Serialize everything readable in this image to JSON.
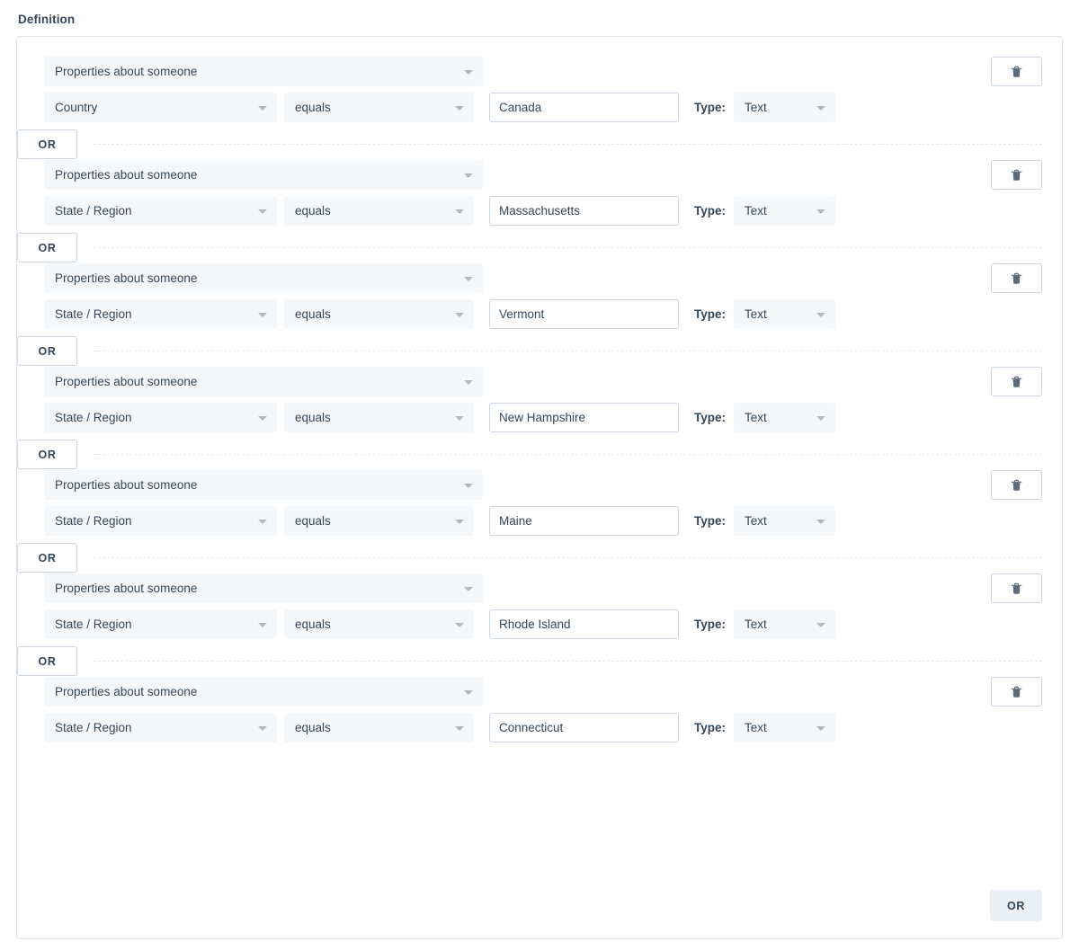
{
  "section": {
    "label": "Definition"
  },
  "icons": {
    "trash": "trash-icon",
    "caret": "chevron-down-icon"
  },
  "labels": {
    "type_label": "Type:",
    "or_label": "OR"
  },
  "colors": {
    "accent_text": "#33475b",
    "field_bg": "#f5f8fa",
    "border": "#cbd6e2",
    "container_border": "#e3e6e8",
    "or_filled_bg": "#eaf0f6"
  },
  "filter_groups": [
    {
      "object_type": "Properties about someone",
      "property": "Country",
      "operator": "equals",
      "value": "Canada",
      "value_type": "Text",
      "delete_label": "",
      "has_or_separator": true
    },
    {
      "object_type": "Properties about someone",
      "property": "State / Region",
      "operator": "equals",
      "value": "Massachusetts",
      "value_type": "Text",
      "delete_label": "",
      "has_or_separator": true
    },
    {
      "object_type": "Properties about someone",
      "property": "State / Region",
      "operator": "equals",
      "value": "Vermont",
      "value_type": "Text",
      "delete_label": "",
      "has_or_separator": true
    },
    {
      "object_type": "Properties about someone",
      "property": "State / Region",
      "operator": "equals",
      "value": "New Hampshire",
      "value_type": "Text",
      "delete_label": "",
      "has_or_separator": true
    },
    {
      "object_type": "Properties about someone",
      "property": "State / Region",
      "operator": "equals",
      "value": "Maine",
      "value_type": "Text",
      "delete_label": "",
      "has_or_separator": true
    },
    {
      "object_type": "Properties about someone",
      "property": "State / Region",
      "operator": "equals",
      "value": "Rhode Island",
      "value_type": "Text",
      "delete_label": "",
      "has_or_separator": true
    },
    {
      "object_type": "Properties about someone",
      "property": "State / Region",
      "operator": "equals",
      "value": "Connecticut",
      "value_type": "Text",
      "delete_label": "",
      "has_or_separator": false
    }
  ],
  "footer": {
    "add_or_label": "OR"
  }
}
